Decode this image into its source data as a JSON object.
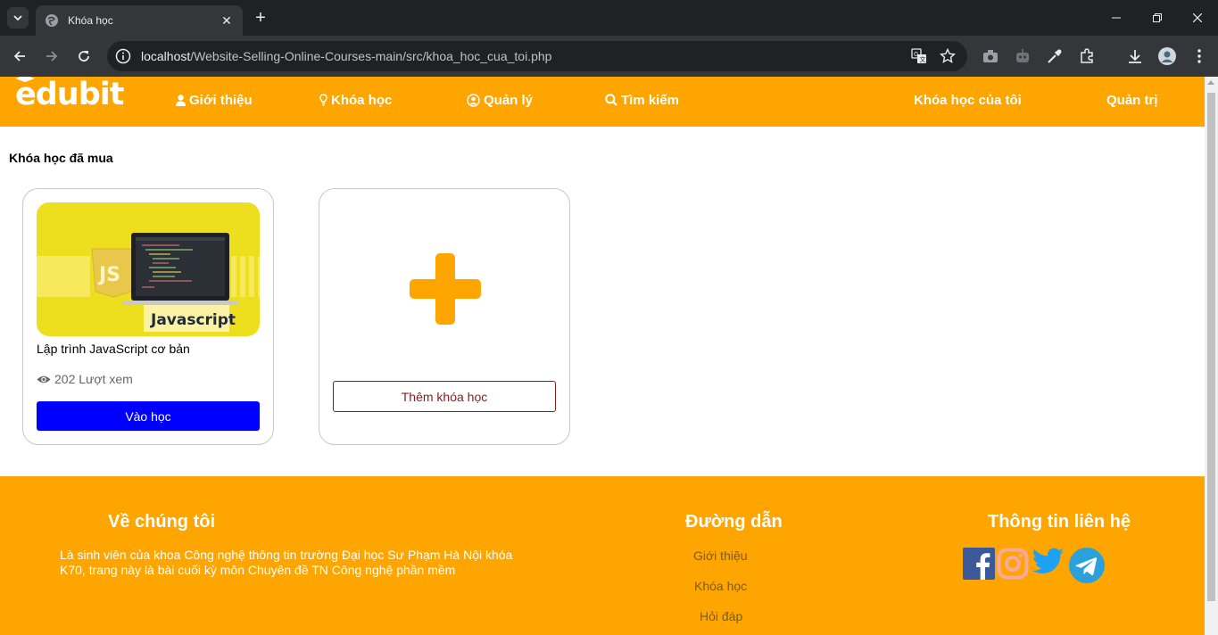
{
  "browser": {
    "tab_title": "Khóa học",
    "url_host": "localhost",
    "url_path": "/Website-Selling-Online-Courses-main/src/khoa_hoc_cua_toi.php"
  },
  "header": {
    "logo_text": "edubit",
    "nav": {
      "about": "Giới thiệu",
      "courses": "Khóa học",
      "manage": "Quản lý",
      "search": "Tìm kiếm",
      "my_courses": "Khóa học của tôi",
      "admin": "Quản trị"
    }
  },
  "main": {
    "section_title": "Khóa học đã mua",
    "course": {
      "title": "Lập trình JavaScript cơ bản",
      "views": "202 Lượt xem",
      "enter_label": "Vào học",
      "thumb_caption": "Javascript",
      "thumb_badge": "JS"
    },
    "add_card": {
      "button_label": "Thêm khóa học"
    }
  },
  "footer": {
    "about_title": "Về chúng tôi",
    "about_text": "Là sinh viên của khoa Công nghệ thông tin trường Đại học Sư Phạm Hà Nội khóa K70, trang này là bài cuối kỳ môn Chuyên đề TN Công nghệ phần mềm",
    "links_title": "Đường dẫn",
    "links": [
      "Giới thiệu",
      "Khóa học",
      "Hỏi đáp"
    ],
    "contact_title": "Thông tin liên hệ",
    "social": [
      "facebook-icon",
      "instagram-icon",
      "twitter-icon",
      "telegram-icon"
    ]
  },
  "colors": {
    "brand": "#ffa500",
    "primary_button": "#0000ff",
    "outline_button": "#8b1a1a"
  }
}
